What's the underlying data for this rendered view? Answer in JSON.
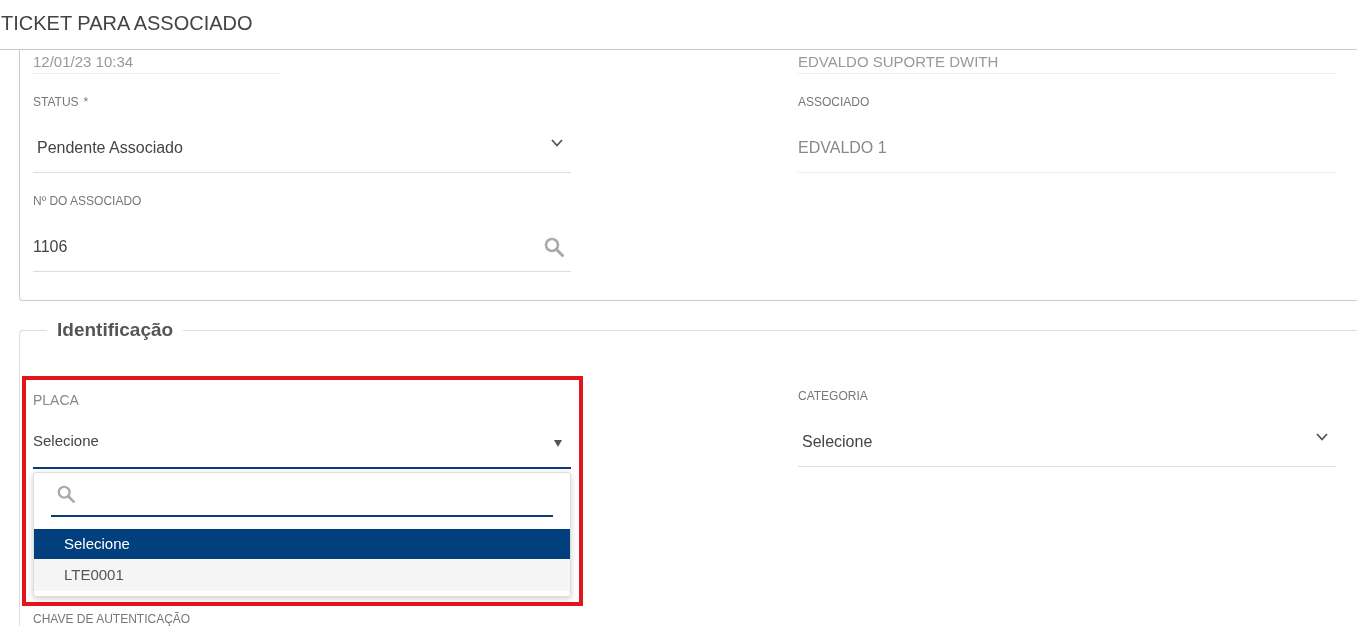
{
  "header": {
    "title": "TICKET PARA ASSOCIADO"
  },
  "general": {
    "rows": [
      {
        "left": {
          "kind": "timestamp",
          "value": "12/01/23 10:34"
        },
        "right": {
          "kind": "readonly",
          "value": "EDVALDO SUPORTE DWITH"
        }
      },
      {
        "left": {
          "kind": "select",
          "label": "STATUS",
          "required_mark": "*",
          "value": "Pendente Associado"
        },
        "right": {
          "kind": "readonly",
          "label": "ASSOCIADO",
          "value": "EDVALDO 1"
        }
      },
      {
        "left": {
          "kind": "lookup",
          "label": "Nº DO ASSOCIADO",
          "value": "1106"
        }
      }
    ]
  },
  "identification": {
    "legend": "Identificação",
    "left": [
      {
        "kind": "combo",
        "label": "PLACA",
        "value": "Selecione",
        "highlighted": true,
        "expanded": true,
        "options": [
          {
            "label": "Selecione",
            "selected": true
          },
          {
            "label": "LTE0001",
            "selected": false
          }
        ]
      },
      {
        "kind": "label",
        "label": "CHAVE DE AUTENTICAÇÃO"
      }
    ],
    "right": [
      {
        "kind": "select",
        "label": "CATEGORIA",
        "value": "Selecione"
      }
    ]
  }
}
